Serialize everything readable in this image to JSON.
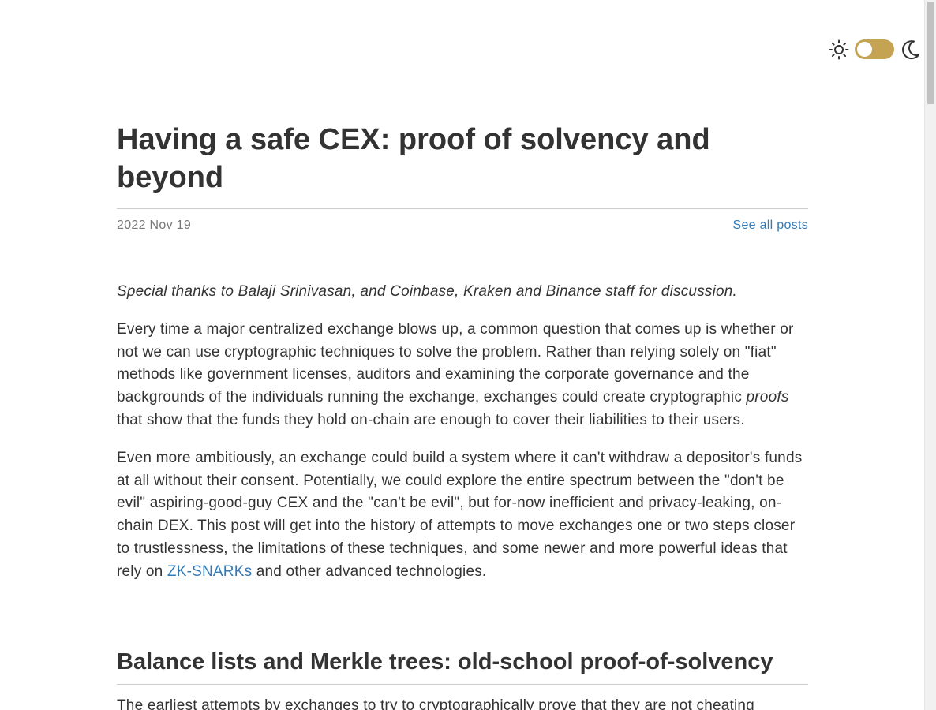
{
  "theme_switch": {
    "sun_icon": "sun-icon",
    "moon_icon": "moon-icon",
    "toggle_color": "#c4a353",
    "mode": "light"
  },
  "post": {
    "title": "Having a safe CEX: proof of solvency and beyond",
    "date": "2022 Nov 19",
    "all_posts_label": "See all posts"
  },
  "content": {
    "thanks": "Special thanks to Balaji Srinivasan, and Coinbase, Kraken and Binance staff for discussion.",
    "para1_before": "Every time a major centralized exchange blows up, a common question that comes up is whether or not we can use cryptographic techniques to solve the problem. Rather than relying solely on \"fiat\" methods like government licenses, auditors and examining the corporate governance and the backgrounds of the individuals running the exchange, exchanges could create cryptographic ",
    "para1_em": "proofs",
    "para1_after": " that show that the funds they hold on-chain are enough to cover their liabilities to their users.",
    "para2_before": "Even more ambitiously, an exchange could build a system where it can't withdraw a depositor's funds at all without their consent. Potentially, we could explore the entire spectrum between the \"don't be evil\" aspiring-good-guy CEX and the \"can't be evil\", but for-now inefficient and privacy-leaking, on-chain DEX. This post will get into the history of attempts to move exchanges one or two steps closer to trustlessness, the limitations of these techniques, and some newer and more powerful ideas that rely on ",
    "para2_link": "ZK-SNARKs",
    "para2_after": " and other advanced technologies.",
    "section_heading": "Balance lists and Merkle trees: old-school proof-of-solvency",
    "section_para_start": "The earliest attempts by exchanges to try to cryptographically prove that they are not cheating"
  },
  "colors": {
    "text": "#333333",
    "link": "#337ab7",
    "muted": "#777777",
    "accent": "#c4a353"
  }
}
